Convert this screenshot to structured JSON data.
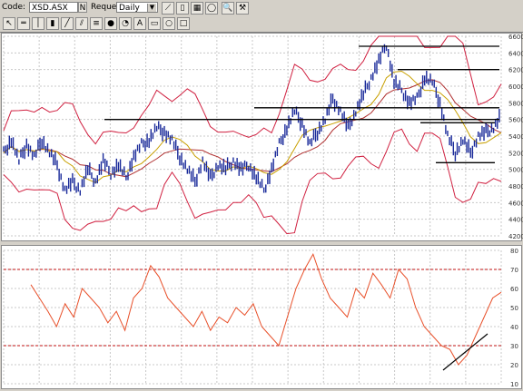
{
  "toolbar": {
    "code_label": "Code:",
    "code_value": "XSD.ASX",
    "request_label": "Request",
    "period_value": "Daily",
    "icons": [
      "n-icon",
      "chart-icon",
      "document-icon",
      "color-palette-icon",
      "ellipse-icon",
      "zoom-icon",
      "tools-icon"
    ]
  },
  "drawing_tools": [
    "pointer-icon",
    "horizontal-line-icon",
    "vertical-line-icon",
    "column-icon",
    "trendline-icon",
    "channel-icon",
    "fibonacci-icon",
    "circle-tool-icon",
    "gann-icon",
    "text-tool-icon",
    "rectangle-tool-icon",
    "ellipse-tool-icon",
    "square-tool-icon"
  ],
  "chart_data": [
    {
      "type": "line",
      "subtype": "bar-ohlc-with-bollinger-bands",
      "ylim": [
        4200,
        6600
      ],
      "yticks": [
        "6600",
        "6400",
        "6200",
        "6000",
        "5800",
        "5600",
        "5400",
        "5200",
        "5000",
        "4800",
        "4600",
        "4400",
        "4200"
      ],
      "grid": true,
      "price_path": [
        [
          0,
          5200
        ],
        [
          2,
          5350
        ],
        [
          4,
          5100
        ],
        [
          6,
          5300
        ],
        [
          8,
          5150
        ],
        [
          10,
          5350
        ],
        [
          12,
          5200
        ],
        [
          14,
          5050
        ],
        [
          16,
          4750
        ],
        [
          18,
          4850
        ],
        [
          20,
          4750
        ],
        [
          22,
          5000
        ],
        [
          24,
          4850
        ],
        [
          26,
          5100
        ],
        [
          28,
          4950
        ],
        [
          30,
          5050
        ],
        [
          32,
          4900
        ],
        [
          34,
          5150
        ],
        [
          36,
          5300
        ],
        [
          38,
          5350
        ],
        [
          40,
          5500
        ],
        [
          42,
          5450
        ],
        [
          44,
          5350
        ],
        [
          46,
          5150
        ],
        [
          48,
          5000
        ],
        [
          50,
          4850
        ],
        [
          52,
          5100
        ],
        [
          54,
          4900
        ],
        [
          56,
          5050
        ],
        [
          58,
          5000
        ],
        [
          60,
          5100
        ],
        [
          62,
          5000
        ],
        [
          64,
          5050
        ],
        [
          66,
          4900
        ],
        [
          68,
          4750
        ],
        [
          70,
          5000
        ],
        [
          72,
          5300
        ],
        [
          74,
          5500
        ],
        [
          76,
          5700
        ],
        [
          78,
          5550
        ],
        [
          80,
          5300
        ],
        [
          82,
          5450
        ],
        [
          84,
          5600
        ],
        [
          86,
          5850
        ],
        [
          88,
          5700
        ],
        [
          90,
          5500
        ],
        [
          92,
          5700
        ],
        [
          94,
          5900
        ],
        [
          96,
          6100
        ],
        [
          98,
          6300
        ],
        [
          100,
          6500
        ],
        [
          102,
          6050
        ],
        [
          104,
          5950
        ],
        [
          106,
          5800
        ],
        [
          108,
          5850
        ],
        [
          110,
          6100
        ],
        [
          112,
          6050
        ],
        [
          114,
          5800
        ],
        [
          116,
          5400
        ],
        [
          118,
          5200
        ],
        [
          120,
          5350
        ],
        [
          122,
          5200
        ],
        [
          124,
          5400
        ],
        [
          126,
          5450
        ],
        [
          128,
          5500
        ],
        [
          130,
          5650
        ]
      ],
      "support_resistance_levels": [
        6480,
        6200,
        5740,
        5600,
        5560,
        5080
      ]
    },
    {
      "type": "line",
      "subtype": "rsi",
      "ylim": [
        10,
        80
      ],
      "yticks": [
        "80",
        "70",
        "60",
        "50",
        "40",
        "30",
        "20",
        "10"
      ],
      "reference_levels": [
        70,
        30
      ],
      "values": [
        62,
        55,
        48,
        40,
        52,
        45,
        60,
        55,
        50,
        42,
        48,
        38,
        55,
        60,
        72,
        66,
        55,
        50,
        45,
        40,
        48,
        38,
        45,
        42,
        50,
        46,
        52,
        40,
        35,
        30,
        45,
        60,
        70,
        78,
        65,
        55,
        50,
        45,
        60,
        55,
        68,
        62,
        55,
        70,
        65,
        50,
        40,
        35,
        30,
        28,
        20,
        25,
        35,
        45,
        55,
        58
      ]
    }
  ]
}
